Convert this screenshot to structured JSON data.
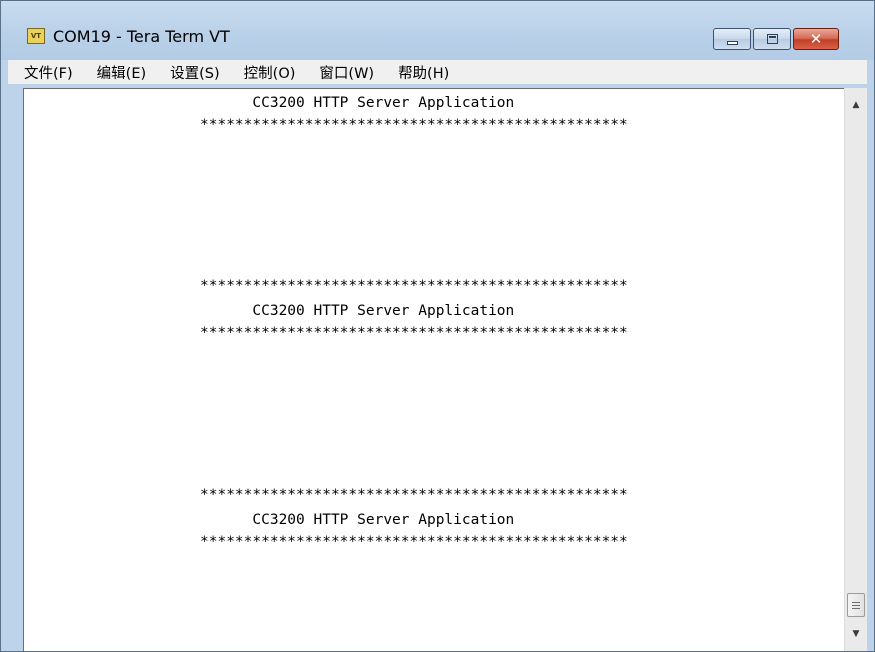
{
  "window": {
    "title": "COM19 - Tera Term VT",
    "icon_label": "VT",
    "close_glyph": "✕"
  },
  "menu": {
    "items": [
      {
        "label": "文件(F)"
      },
      {
        "label": "编辑(E)"
      },
      {
        "label": "设置(S)"
      },
      {
        "label": "控制(O)"
      },
      {
        "label": "窗口(W)"
      },
      {
        "label": "帮助(H)"
      }
    ]
  },
  "terminal": {
    "lines": [
      "      CC3200 HTTP Server Application",
      "*************************************************",
      "*************************************************",
      "      CC3200 HTTP Server Application",
      "*************************************************",
      "*************************************************",
      "      CC3200 HTTP Server Application",
      "*************************************************"
    ]
  },
  "scrollbar": {
    "up_arrow": "▲",
    "down_arrow": "▼"
  }
}
